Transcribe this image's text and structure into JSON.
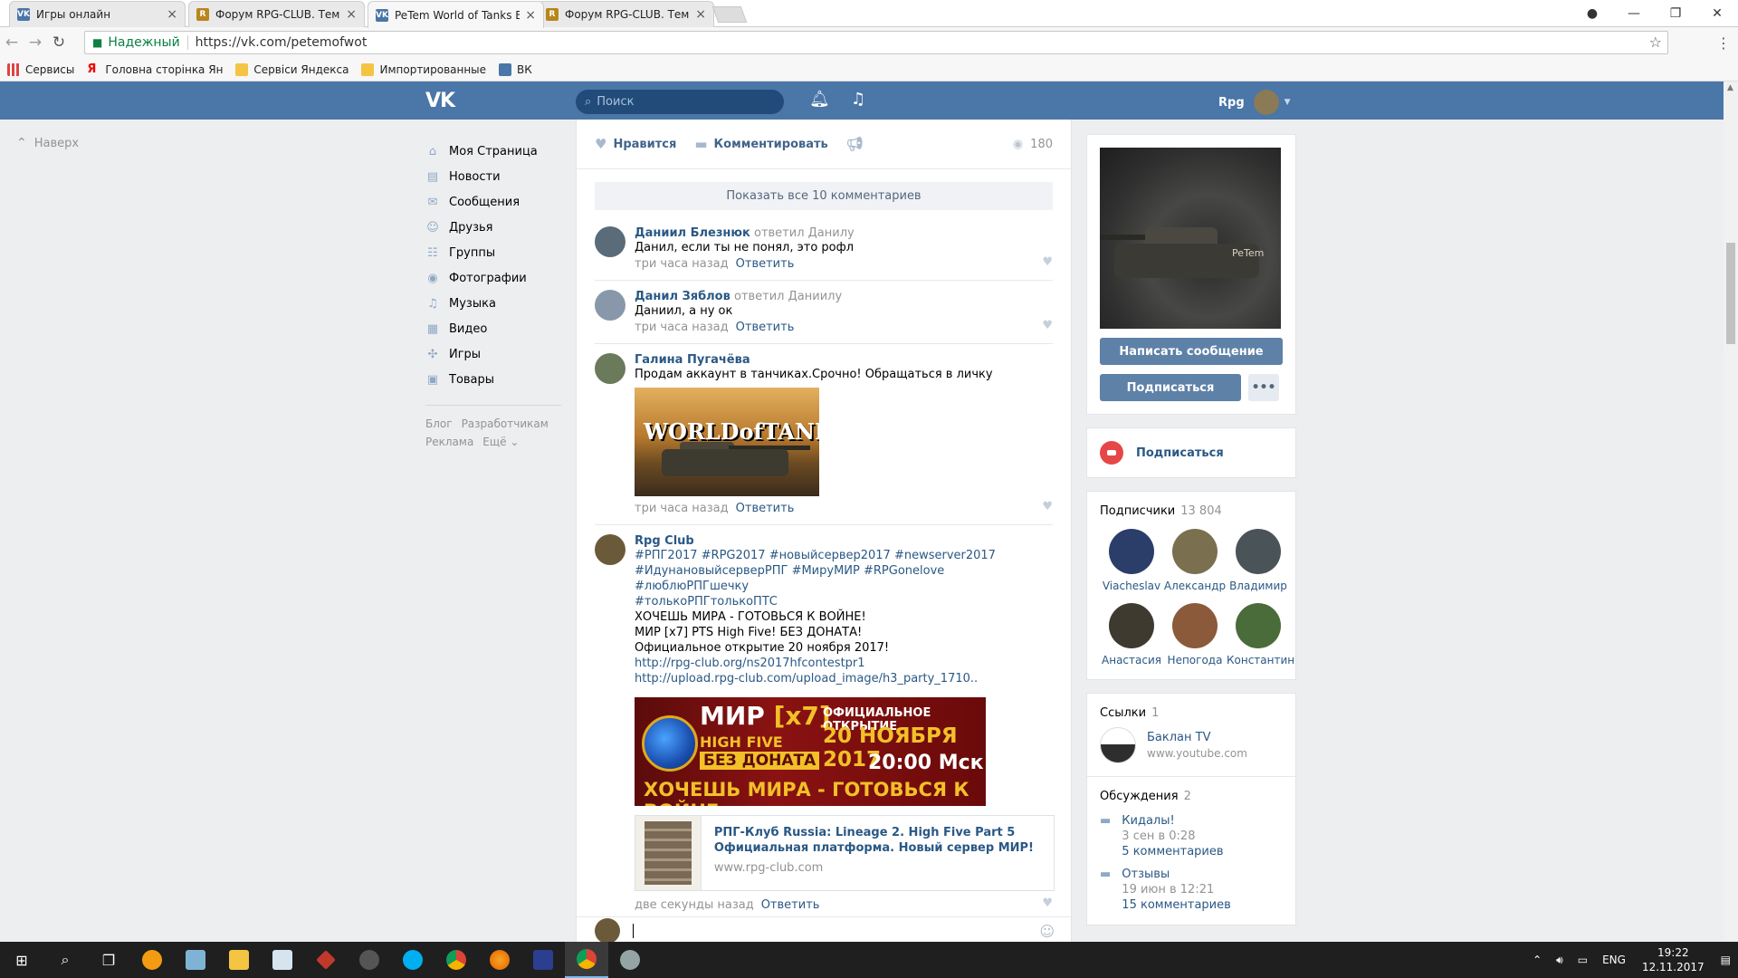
{
  "browser": {
    "tabs": [
      {
        "title": "Игры онлайн",
        "fav": "VK",
        "fav_color": "#4a76a8"
      },
      {
        "title": "Форум RPG-CLUB. Тема",
        "fav": "R",
        "fav_color": "#b8861b"
      },
      {
        "title": "PeTem World of Tanks BL",
        "fav": "VK",
        "fav_color": "#4a76a8"
      },
      {
        "title": "Форум RPG-CLUB. Тема",
        "fav": "R",
        "fav_color": "#b8861b"
      }
    ],
    "secure_label": "Надежный",
    "url": "https://vk.com/petemofwot",
    "bookmarks": [
      {
        "label": "Сервисы",
        "color": "#d44"
      },
      {
        "label": "Головна сторінка Ян",
        "color": "#e00"
      },
      {
        "label": "Сервіси Яндекса",
        "color": "#f4c542"
      },
      {
        "label": "Импортированные",
        "color": "#f4c542"
      },
      {
        "label": "ВК",
        "color": "#4a76a8"
      }
    ]
  },
  "vk": {
    "logo": "VK",
    "search_placeholder": "Поиск",
    "user_name": "Rpg",
    "up_label": "Наверх",
    "menu": [
      {
        "label": "Моя Страница",
        "icon": "home-icon",
        "glyph": "⌂"
      },
      {
        "label": "Новости",
        "icon": "news-icon",
        "glyph": "▤"
      },
      {
        "label": "Сообщения",
        "icon": "messages-icon",
        "glyph": "✉"
      },
      {
        "label": "Друзья",
        "icon": "friends-icon",
        "glyph": "☺"
      },
      {
        "label": "Группы",
        "icon": "groups-icon",
        "glyph": "☷"
      },
      {
        "label": "Фотографии",
        "icon": "camera-icon",
        "glyph": "◉"
      },
      {
        "label": "Музыка",
        "icon": "music-icon",
        "glyph": "♫"
      },
      {
        "label": "Видео",
        "icon": "video-icon",
        "glyph": "▦"
      },
      {
        "label": "Игры",
        "icon": "gamepad-icon",
        "glyph": "✣"
      },
      {
        "label": "Товары",
        "icon": "bag-icon",
        "glyph": "▣"
      }
    ],
    "footer": {
      "blog": "Блог",
      "dev": "Разработчикам",
      "ads": "Реклама",
      "more": "Ещё ⌄"
    }
  },
  "post": {
    "like_label": "Нравится",
    "comment_label": "Комментировать",
    "views": "180",
    "show_all": "Показать все 10 комментариев",
    "answer_label": "Ответить",
    "comments": [
      {
        "author": "Даниил Блезнюк",
        "reply": "ответил Данилу",
        "text": "Данил, если ты не понял, это рофл",
        "time": "три часа назад",
        "ava": "#5a6b7a"
      },
      {
        "author": "Данил Зяблов",
        "reply": "ответил Даниилу",
        "text": "Даниил, а ну ок",
        "time": "три часа назад",
        "ava": "#8898aa"
      },
      {
        "author": "Галина Пугачёва",
        "reply": "",
        "text": "Продам аккаунт в танчиках.Срочно! Обращаться в личку",
        "time": "три часа назад",
        "ava": "#6a7a5a"
      }
    ],
    "wot_logo": "WORLDofTANKS",
    "rpg": {
      "author": "Rpg Club",
      "tags1": "#РПГ2017 #RPG2017 #новыйсервер2017 #newserver2017",
      "tags2": "#ИдунановыйсерверРПГ #МируМИР #RPGonelove #люблюРПГшечку",
      "tags3": "#толькоРПГтолькоПТС",
      "line1": "ХОЧЕШЬ МИРА - ГОТОВЬСЯ К ВОЙНЕ!",
      "line2": "МИР [x7] PTS High Five! БЕЗ ДОНАТА!",
      "line3": "Официальное открытие 20 ноября 2017!",
      "link1": "http://rpg-club.org/ns2017hfcontestpr1",
      "link2": "http://upload.rpg-club.com/upload_image/h3_party_1710..",
      "time": "две секунды назад",
      "banner": {
        "mir": "МИР ",
        "x7": "[x7]",
        "hf": "HIGH FIVE",
        "nodonate": "БЕЗ ДОНАТА",
        "open": "ОФИЦИАЛЬНОЕ ОТКРЫТИЕ",
        "date": "20 НОЯБРЯ 2017",
        "hour": "20:00 Мск",
        "war": "ХОЧЕШЬ МИРА - ГОТОВЬСЯ К ВОЙНЕ"
      },
      "card_title": "РПГ-Клуб Russia: Lineage 2. High Five Part 5 Официальная платформа. Новый сервер МИР!",
      "card_site": "www.rpg-club.com"
    }
  },
  "sidebar": {
    "cover_text": "PeTem",
    "write_msg": "Написать сообщение",
    "subscribe": "Подписаться",
    "more": "•••",
    "sub_label": "Подписаться",
    "followers_title": "Подписчики",
    "followers_count": "13 804",
    "followers": [
      {
        "name": "Viacheslav",
        "ava": "#2b3e6a"
      },
      {
        "name": "Александр",
        "ava": "#7a7050"
      },
      {
        "name": "Владимир",
        "ava": "#4a5358"
      },
      {
        "name": "Анастасия",
        "ava": "#3e3a30"
      },
      {
        "name": "Непогода",
        "ava": "#8b5a3a"
      },
      {
        "name": "Константин",
        "ava": "#4a6b3a"
      }
    ],
    "links_title": "Ссылки",
    "links_count": "1",
    "link_name": "Баклан TV",
    "link_site": "www.youtube.com",
    "disc_title": "Обсуждения",
    "disc_count": "2",
    "discussions": [
      {
        "title": "Кидалы!",
        "date": "3 сен в 0:28",
        "count": "5 комментариев"
      },
      {
        "title": "Отзывы",
        "date": "19 июн в 12:21",
        "count": "15 комментариев"
      }
    ]
  },
  "taskbar": {
    "lang": "ENG",
    "time": "19:22",
    "date": "12.11.2017"
  }
}
